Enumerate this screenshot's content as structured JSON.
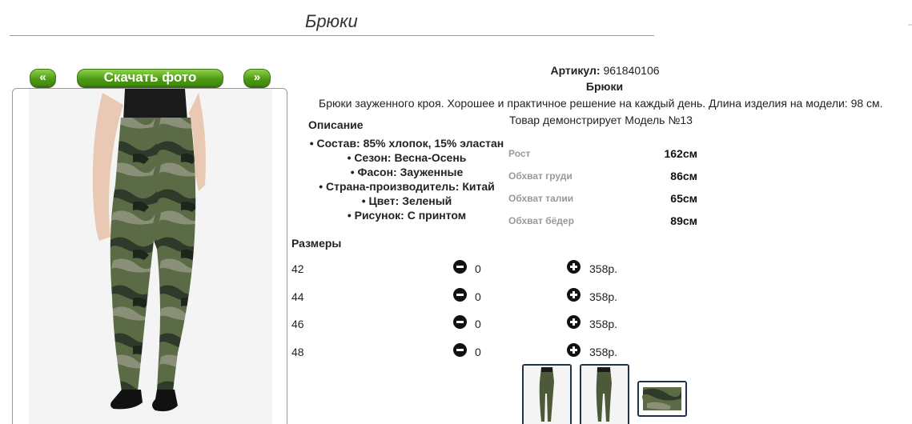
{
  "page": {
    "title": "Брюки"
  },
  "gallery": {
    "prev_label": "«",
    "download_label": "Скачать фото",
    "next_label": "»"
  },
  "product": {
    "sku_label": "Артикул:",
    "sku_value": "961840106",
    "name": "Брюки",
    "description": "Брюки зауженного кроя. Хорошее и практичное решение на каждый день. Длина изделия на модели: 98 см.",
    "model_note": "Товар демонстрирует Модель №13",
    "attributes_heading": "Описание",
    "attributes": [
      "Состав: 85% хлопок, 15% эластан",
      "Сезон: Весна-Осень",
      "Фасон: Зауженные",
      "Страна-производитель: Китай",
      "Цвет: Зеленый",
      "Рисунок: С принтом"
    ]
  },
  "model_measurements": [
    {
      "label": "Рост",
      "value": "162см"
    },
    {
      "label": "Обхват груди",
      "value": "86см"
    },
    {
      "label": "Обхват талии",
      "value": "65см"
    },
    {
      "label": "Обхват бёдер",
      "value": "89см"
    }
  ],
  "sizes": {
    "heading": "Размеры",
    "rows": [
      {
        "size": "42",
        "qty": "0",
        "price": "358р."
      },
      {
        "size": "44",
        "qty": "0",
        "price": "358р."
      },
      {
        "size": "46",
        "qty": "0",
        "price": "358р."
      },
      {
        "size": "48",
        "qty": "0",
        "price": "358р."
      }
    ]
  },
  "colors": {
    "button_green": "#4d9a14",
    "camo_dark": "#2f3a2a",
    "camo_olive": "#5b6b45",
    "camo_light": "#8a8f78",
    "thumb_border": "#1f3346"
  }
}
